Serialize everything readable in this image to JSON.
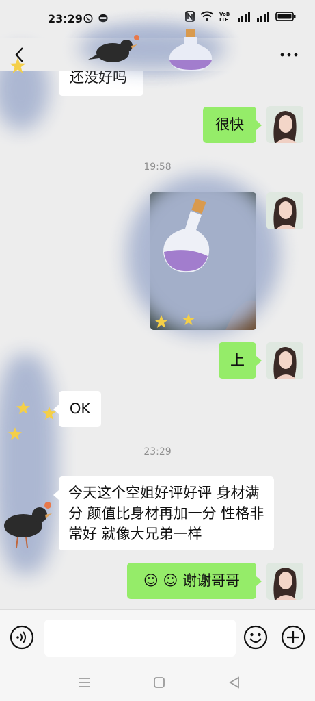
{
  "status_bar": {
    "time": "23:29"
  },
  "header": {
    "back_label": "<",
    "more_label": "···"
  },
  "messages": {
    "m1_text": "还没好吗",
    "m2_text": "很快",
    "time1": "19:58",
    "m4_text": "上",
    "m5_text": "OK",
    "time2": "23:29",
    "m6_text": "今天这个空姐好评好评 身材满分 颜值比身材再加一分 性格非常好 就像大兄弟一样",
    "m7_text": "☺ ☺ 谢谢哥哥"
  },
  "input": {
    "placeholder": ""
  },
  "colors": {
    "background": "#ededed",
    "self_bubble": "#95ec69",
    "other_bubble": "#ffffff",
    "blur": "#a9b5d1"
  },
  "icons": [
    "back-icon",
    "more-icon",
    "voice-icon",
    "emoji-icon",
    "plus-icon",
    "menu-icon",
    "home-icon",
    "back-triangle-icon"
  ]
}
